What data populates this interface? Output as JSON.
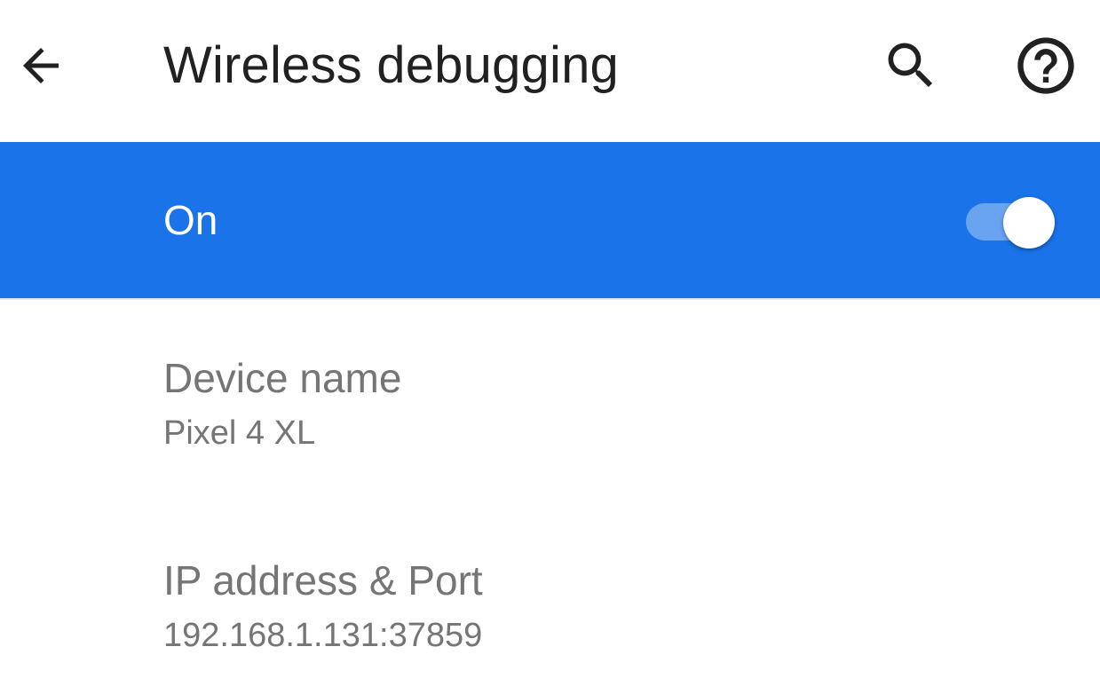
{
  "app_bar": {
    "title": "Wireless debugging",
    "icons": {
      "back": "back-arrow-icon",
      "search": "search-icon",
      "help": "help-icon"
    }
  },
  "master_switch": {
    "label": "On",
    "state": "on",
    "color": "#1a73e8"
  },
  "preferences": [
    {
      "title": "Device name",
      "summary": "Pixel 4 XL"
    },
    {
      "title": "IP address & Port",
      "summary": "192.168.1.131:37859"
    }
  ]
}
